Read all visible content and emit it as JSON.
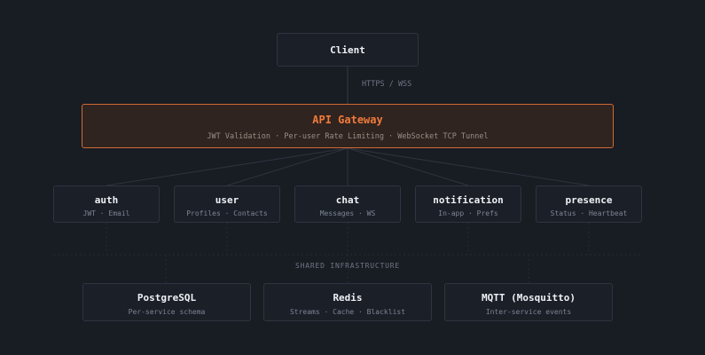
{
  "client": {
    "title": "Client"
  },
  "protocol_label": "HTTPS / WSS",
  "gateway": {
    "title": "API Gateway",
    "subtitle": "JWT Validation · Per-user Rate Limiting · WebSocket TCP Tunnel"
  },
  "services": [
    {
      "title": "auth",
      "subtitle": "JWT · Email"
    },
    {
      "title": "user",
      "subtitle": "Profiles · Contacts"
    },
    {
      "title": "chat",
      "subtitle": "Messages · WS"
    },
    {
      "title": "notification",
      "subtitle": "In-app · Prefs"
    },
    {
      "title": "presence",
      "subtitle": "Status · Heartbeat"
    }
  ],
  "infra_label": "SHARED INFRASTRUCTURE",
  "infrastructure": [
    {
      "title": "PostgreSQL",
      "subtitle": "Per-service schema"
    },
    {
      "title": "Redis",
      "subtitle": "Streams · Cache · Blacklist"
    },
    {
      "title": "MQTT (Mosquitto)",
      "subtitle": "Inter-service events"
    }
  ],
  "colors": {
    "background": "#181c23",
    "accent": "#f07a3c",
    "box_border": "#2f3440",
    "connector": "#353b47"
  }
}
